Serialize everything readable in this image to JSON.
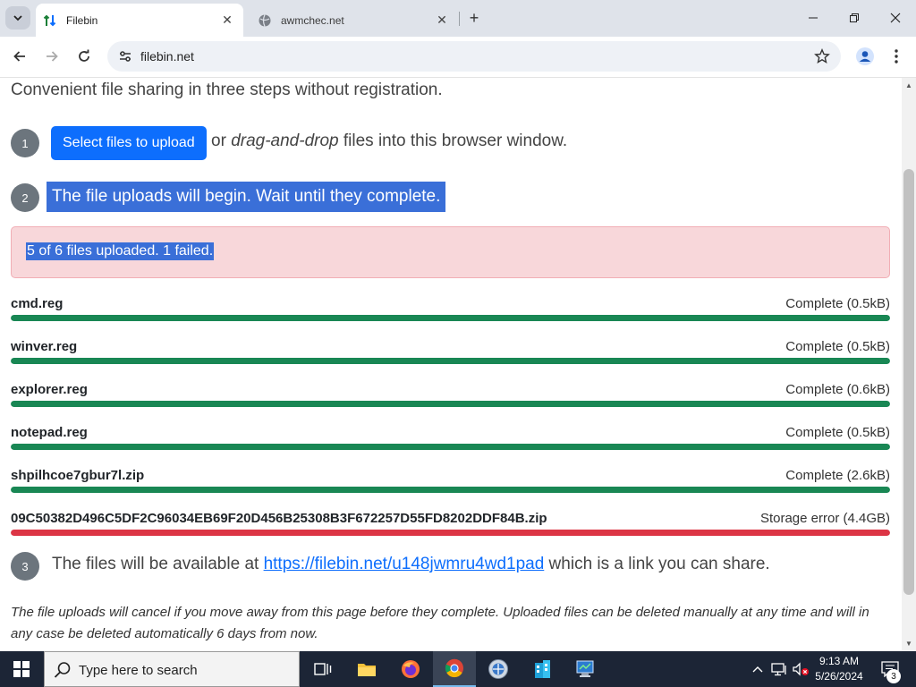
{
  "browser": {
    "tabs": [
      {
        "title": "Filebin",
        "active": true,
        "favicon": "filebin-arrows-icon"
      },
      {
        "title": "awmchec.net",
        "active": false,
        "favicon": "globe-icon"
      }
    ],
    "url": "filebin.net"
  },
  "page": {
    "lead": "Convenient file sharing in three steps without registration.",
    "steps": {
      "one_num": "1",
      "upload_button": "Select files to upload",
      "one_or": "or ",
      "one_em": "drag-and-drop",
      "one_rest": " files into this browser window.",
      "two_num": "2",
      "two_text": "The file uploads will begin. Wait until they complete.",
      "three_num": "3",
      "three_pre": "The files will be available at ",
      "three_link": "https://filebin.net/u148jwmru4wd1pad",
      "three_post": " which is a link you can share."
    },
    "alert": "5 of 6 files uploaded. 1 failed.",
    "files": [
      {
        "name": "cmd.reg",
        "status": "Complete (0.5kB)",
        "progress": 1.0,
        "color": "#198754"
      },
      {
        "name": "winver.reg",
        "status": "Complete (0.5kB)",
        "progress": 1.0,
        "color": "#198754"
      },
      {
        "name": "explorer.reg",
        "status": "Complete (0.6kB)",
        "progress": 1.0,
        "color": "#198754"
      },
      {
        "name": "notepad.reg",
        "status": "Complete (0.5kB)",
        "progress": 1.0,
        "color": "#198754"
      },
      {
        "name": "shpilhcoe7gbur7l.zip",
        "status": "Complete (2.6kB)",
        "progress": 1.0,
        "color": "#198754"
      },
      {
        "name": "09C50382D496C5DF2C96034EB69F20D456B25308B3F672257D55FD8202DDF84B.zip",
        "status": "Storage error (4.4GB)",
        "progress": 1.0,
        "color": "#dc3545"
      }
    ],
    "note": "The file uploads will cancel if you move away from this page before they complete. Uploaded files can be deleted manually at any time and will in any case be deleted automatically 6 days from now."
  },
  "taskbar": {
    "search_placeholder": "Type here to search",
    "time": "9:13 AM",
    "date": "5/26/2024",
    "notification_count": "3",
    "apps": [
      "task-view-icon",
      "file-explorer-icon",
      "firefox-icon",
      "chrome-icon",
      "app-icon",
      "building-icon",
      "network-monitor-icon"
    ]
  }
}
